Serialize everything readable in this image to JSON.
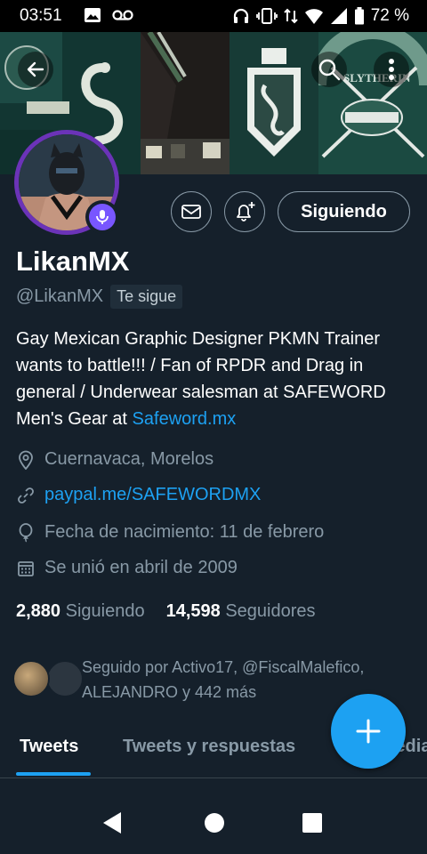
{
  "status_bar": {
    "time": "03:51",
    "battery": "72 %"
  },
  "profile": {
    "name": "LikanMX",
    "handle": "@LikanMX",
    "follows_you": "Te sigue",
    "follow_button": "Siguiendo",
    "bio_text": "Gay Mexican Graphic Designer PKMN Trainer wants to battle!!! / Fan of RPDR and Drag in general / Underwear salesman at SAFEWORD Men's Gear at ",
    "bio_link": "Safeword.mx",
    "location": "Cuernavaca, Morelos",
    "website": "paypal.me/SAFEWORDMX",
    "birthday": "Fecha de nacimiento: 11 de febrero",
    "joined": "Se unió en abril de 2009",
    "following_count": "2,880",
    "following_label": "Siguiendo",
    "followers_count": "14,598",
    "followers_label": "Seguidores",
    "followed_by": "Seguido por Activo17, @FiscalMalefico, ALEJANDRO y 442 más"
  },
  "header_art": {
    "banner_texts": [
      "SLYTHERIN",
      "SLYTHERIN"
    ]
  },
  "tabs": [
    {
      "label": "Tweets",
      "active": true
    },
    {
      "label": "Tweets y respuestas",
      "active": false
    },
    {
      "label": "Multimedia",
      "active": false
    }
  ],
  "colors": {
    "background": "#15202b",
    "accent": "#1da1f2",
    "muted": "#8899a6",
    "avatar_ring": "#6b33b8"
  }
}
